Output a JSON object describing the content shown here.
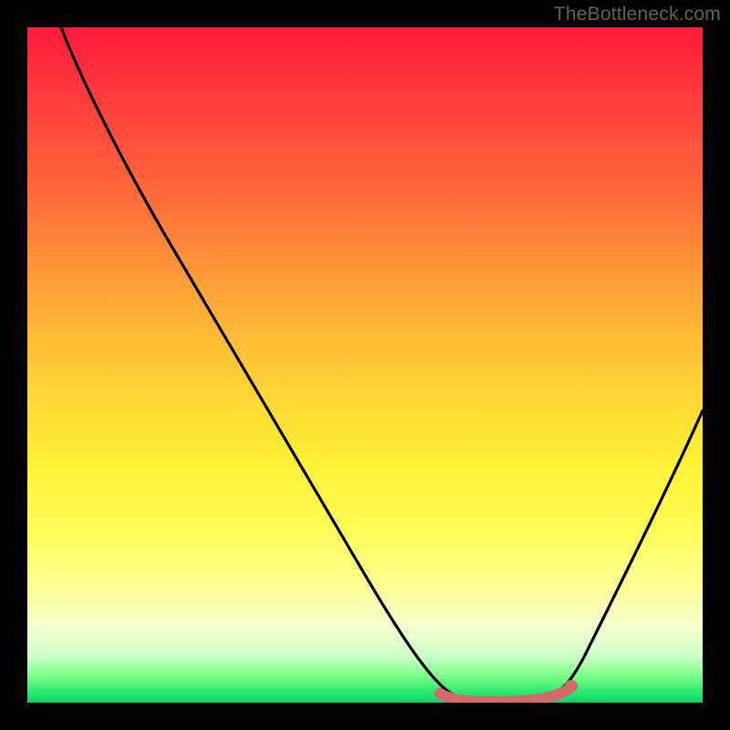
{
  "watermark": "TheBottleneck.com",
  "chart_data": {
    "type": "line",
    "title": "",
    "xlabel": "",
    "ylabel": "",
    "xlim": [
      0,
      100
    ],
    "ylim": [
      0,
      100
    ],
    "series": [
      {
        "name": "curve",
        "color": "#000000",
        "x": [
          5,
          10,
          15,
          20,
          25,
          30,
          35,
          40,
          45,
          50,
          55,
          60,
          62,
          65,
          68,
          72,
          75,
          78,
          80,
          85,
          90,
          95,
          100
        ],
        "y": [
          100,
          93,
          86,
          78,
          70,
          62,
          54,
          46,
          38,
          29,
          20,
          11,
          7,
          3,
          1,
          0.5,
          1,
          3,
          7,
          18,
          30,
          42,
          55
        ]
      }
    ],
    "flat_region": {
      "color": "#d26a6a",
      "x_start": 62,
      "x_end": 80,
      "y": 0.7,
      "endpoint_x": 80,
      "endpoint_y": 2
    },
    "gradient_stops": [
      {
        "pos": 0.0,
        "color": "#ff1a3c"
      },
      {
        "pos": 0.25,
        "color": "#ff6a3a"
      },
      {
        "pos": 0.5,
        "color": "#ffcf36"
      },
      {
        "pos": 0.75,
        "color": "#fffc55"
      },
      {
        "pos": 0.93,
        "color": "#cfffc9"
      },
      {
        "pos": 1.0,
        "color": "#0fd463"
      }
    ]
  }
}
